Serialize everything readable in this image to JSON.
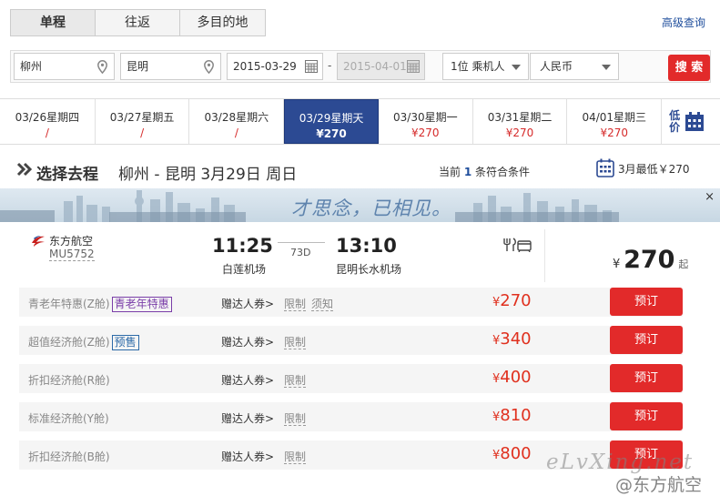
{
  "trip_tabs": [
    {
      "label": "单程",
      "active": true
    },
    {
      "label": "往返",
      "active": false
    },
    {
      "label": "多目的地",
      "active": false
    }
  ],
  "advanced_search": "高级查询",
  "search": {
    "from": "柳州",
    "to": "昆明",
    "depart_date": "2015-03-29",
    "return_date": "2015-04-01",
    "passengers": "1位 乘机人",
    "currency": "人民币",
    "search_button": "搜 索"
  },
  "date_strip": [
    {
      "date": "03/26星期四",
      "price": "/"
    },
    {
      "date": "03/27星期五",
      "price": "/"
    },
    {
      "date": "03/28星期六",
      "price": "/"
    },
    {
      "date": "03/29星期天",
      "price": "¥270",
      "active": true
    },
    {
      "date": "03/30星期一",
      "price": "¥270"
    },
    {
      "date": "03/31星期二",
      "price": "¥270"
    },
    {
      "date": "04/01星期三",
      "price": "¥270"
    }
  ],
  "low_price_calendar": "低价",
  "header": {
    "title": "选择去程",
    "route": "柳州 - 昆明  3月29日 周日",
    "count_prefix": "当前",
    "count": "1",
    "count_suffix": "条符合条件",
    "month_low": "3月最低￥270"
  },
  "banner": {
    "text": "才思念，已相见。",
    "close": "×"
  },
  "flight": {
    "airline": "东方航空",
    "flight_no": "MU5752",
    "dep_time": "11:25",
    "dep_airport": "白莲机场",
    "aircraft": "73D",
    "arr_time": "13:10",
    "arr_airport": "昆明长水机场",
    "currency": "¥",
    "min_price": "270",
    "min_suffix": "起"
  },
  "fares": [
    {
      "name": "青老年特惠(Z舱)",
      "tag": "青老年特惠",
      "tag_type": "youth",
      "gift": "赠达人券>",
      "limits": [
        "限制",
        "须知"
      ],
      "currency": "¥",
      "price": "270",
      "book": "预订"
    },
    {
      "name": "超值经济舱(Z舱)",
      "tag": "预售",
      "tag_type": "pre",
      "gift": "赠达人券>",
      "limits": [
        "限制"
      ],
      "currency": "¥",
      "price": "340",
      "book": "预订"
    },
    {
      "name": "折扣经济舱(R舱)",
      "tag": "",
      "tag_type": "",
      "gift": "赠达人券>",
      "limits": [
        "限制"
      ],
      "currency": "¥",
      "price": "400",
      "book": "预订"
    },
    {
      "name": "标准经济舱(Y舱)",
      "tag": "",
      "tag_type": "",
      "gift": "赠达人券>",
      "limits": [
        "限制"
      ],
      "currency": "¥",
      "price": "810",
      "book": "预订"
    },
    {
      "name": "折扣经济舱(B舱)",
      "tag": "",
      "tag_type": "",
      "gift": "赠达人券>",
      "limits": [
        "限制"
      ],
      "currency": "¥",
      "price": "800",
      "book": "预订"
    }
  ],
  "watermarks": [
    "eLvXing.net",
    "@东方航空"
  ],
  "colors": {
    "accent_red": "#e22a2a",
    "nav_blue": "#2c4a93",
    "price_red": "#e0301e"
  }
}
